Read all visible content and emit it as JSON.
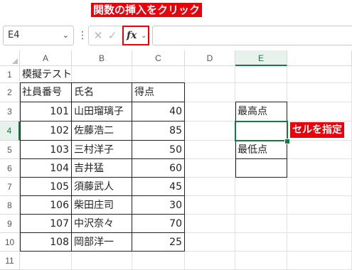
{
  "callouts": {
    "insert_function": "関数の挿入をクリック",
    "select_cell": "セルを指定"
  },
  "formula_bar": {
    "name_box": "E4",
    "more_icon": "⋮",
    "cancel_glyph": "✕",
    "enter_glyph": "✓",
    "fx_label": "fx",
    "formula_value": ""
  },
  "columns": [
    "A",
    "B",
    "C",
    "D",
    "E"
  ],
  "selected_column": "E",
  "rows": [
    "1",
    "2",
    "3",
    "4",
    "5",
    "6",
    "7",
    "8",
    "9",
    "10",
    "11"
  ],
  "selected_row": "4",
  "sheet": {
    "title": "模擬テスト",
    "headers": [
      "社員番号",
      "氏名",
      "得点"
    ],
    "records": [
      {
        "id": "101",
        "name": "山田瑠璃子",
        "score": "40"
      },
      {
        "id": "102",
        "name": "佐藤浩二",
        "score": "85"
      },
      {
        "id": "103",
        "name": "三村洋子",
        "score": "50"
      },
      {
        "id": "104",
        "name": "吉井猛",
        "score": "60"
      },
      {
        "id": "105",
        "name": "須藤武人",
        "score": "45"
      },
      {
        "id": "106",
        "name": "柴田庄司",
        "score": "30"
      },
      {
        "id": "107",
        "name": "中沢奈々",
        "score": "70"
      },
      {
        "id": "108",
        "name": "岡部洋一",
        "score": "25"
      }
    ],
    "stats": {
      "max_label": "最高点",
      "max_value": "",
      "min_label": "最低点",
      "min_value": ""
    }
  },
  "accent_color": "#107c41",
  "callout_color": "#e8000b"
}
